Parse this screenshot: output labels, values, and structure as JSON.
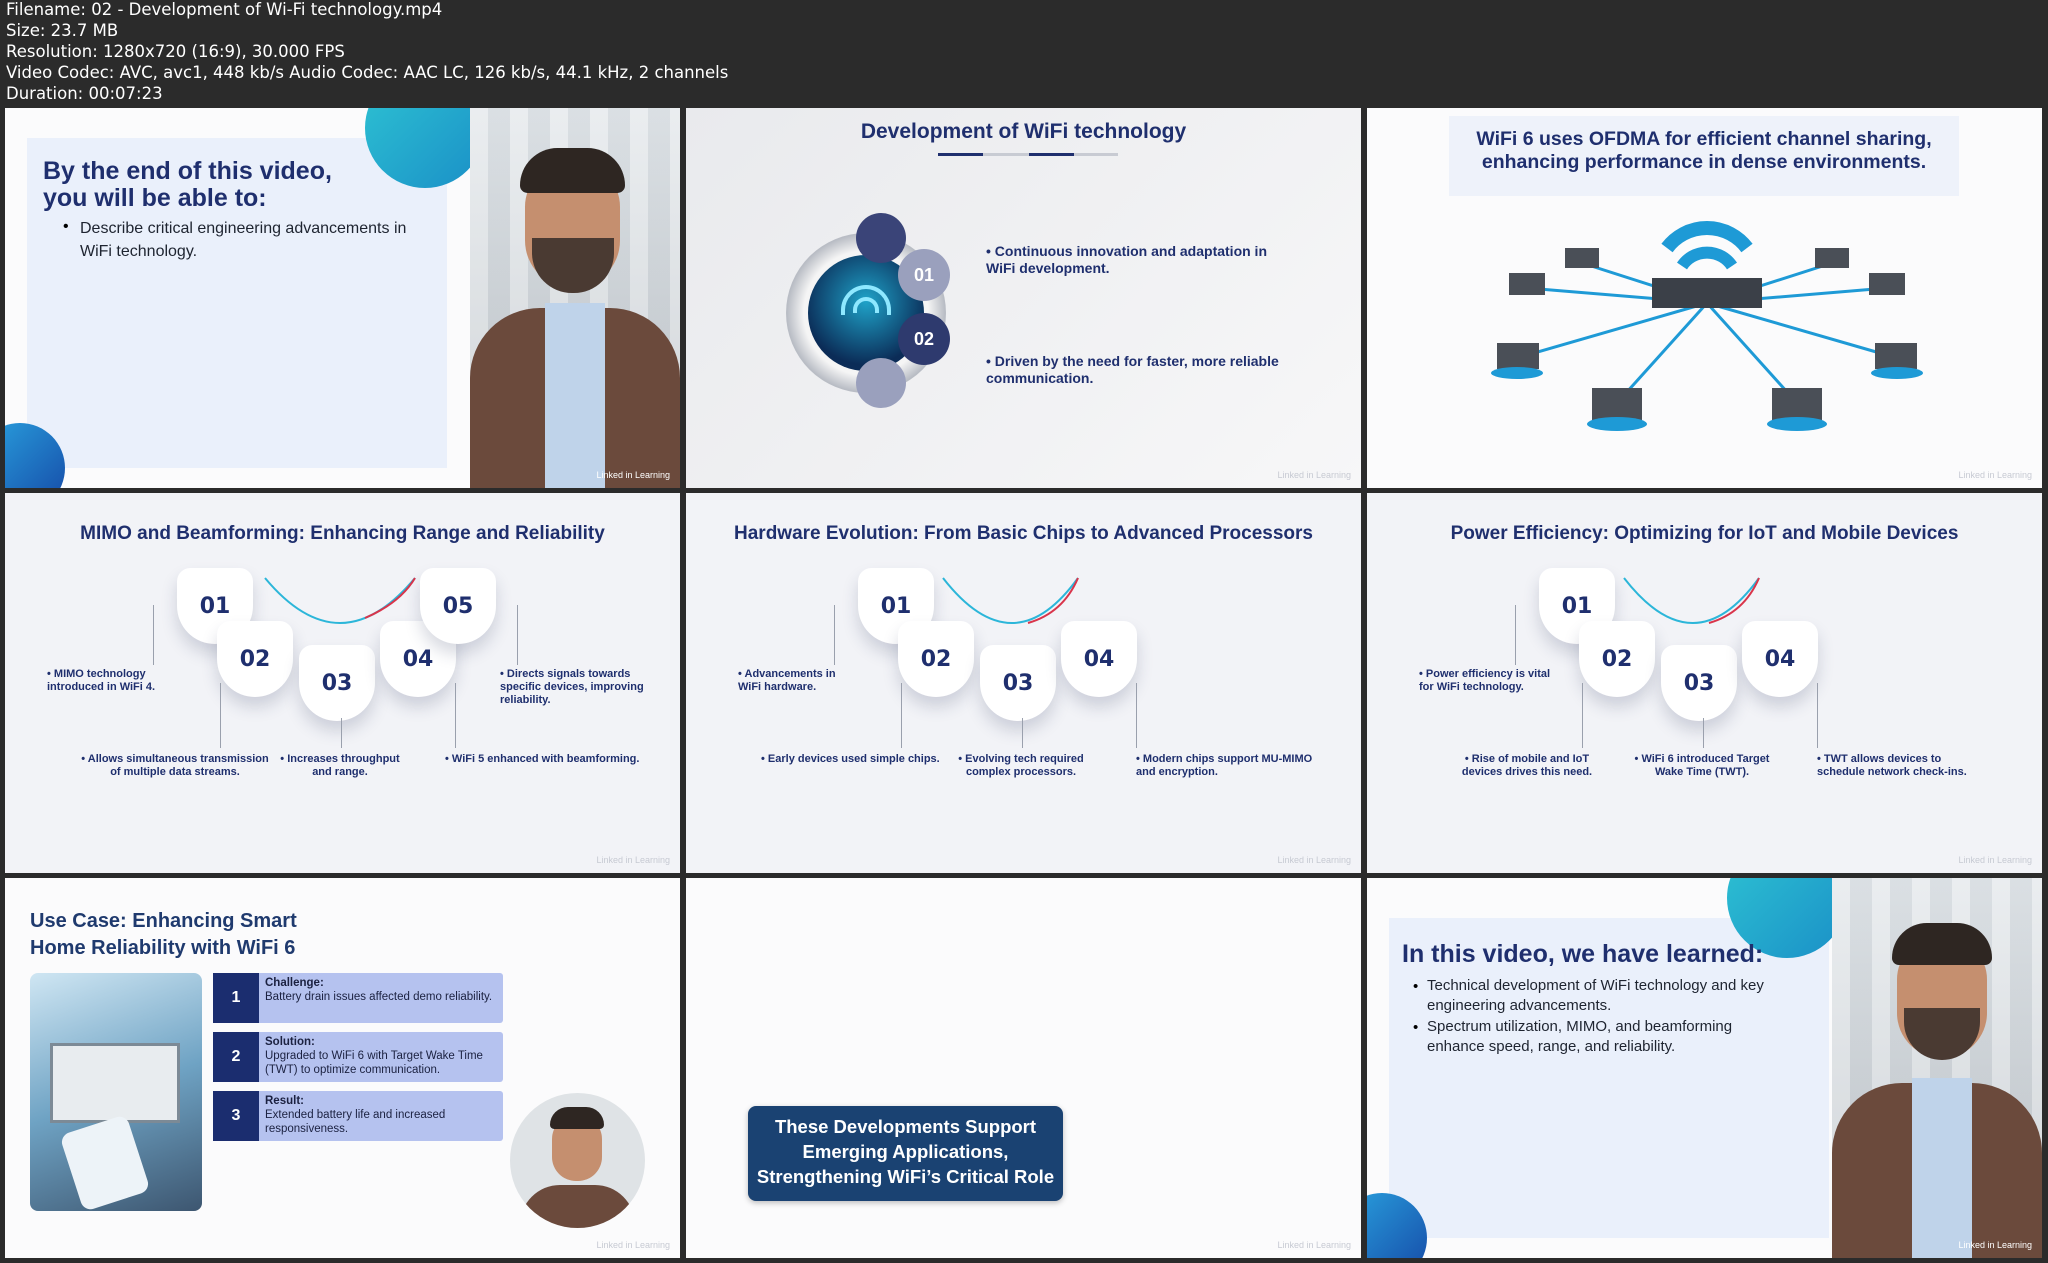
{
  "file_info": {
    "filename": "Filename: 02 - Development of Wi-Fi technology.mp4",
    "size": "Size: 23.7 MB",
    "resolution": "Resolution: 1280x720 (16:9), 30.000 FPS",
    "codec": "Video Codec: AVC, avc1, 448 kb/s Audio Codec: AAC LC, 126 kb/s, 44.1 kHz, 2 channels",
    "duration": "Duration: 00:07:23"
  },
  "frames": {
    "f1": {
      "heading": "By the end of this video, you will be able to:",
      "bullet": "Describe critical engineering advancements in WiFi technology.",
      "watermark": "Linked in Learning"
    },
    "f2": {
      "title": "Development of WiFi technology",
      "num1": "01",
      "num2": "02",
      "point1": "Continuous innovation and adaptation in WiFi development.",
      "point2": "Driven by the need for faster, more reliable communication.",
      "watermark": "Linked in Learning"
    },
    "f3": {
      "caption": "WiFi 6 uses OFDMA for efficient channel sharing, enhancing performance in dense environments.",
      "watermark": "Linked in Learning"
    },
    "f4": {
      "title": "MIMO and Beamforming: Enhancing Range and Reliability",
      "nums": [
        "01",
        "02",
        "03",
        "04",
        "05"
      ],
      "n1": "MIMO technology introduced in WiFi 4.",
      "n2": "Allows simultaneous transmission of multiple data streams.",
      "n3": "Increases throughput and range.",
      "n4": "WiFi 5 enhanced with beamforming.",
      "n5": "Directs signals towards specific devices, improving reliability.",
      "watermark": "Linked in Learning"
    },
    "f5": {
      "title": "Hardware Evolution: From Basic Chips to Advanced Processors",
      "nums": [
        "01",
        "02",
        "03",
        "04"
      ],
      "n1": "Advancements in WiFi hardware.",
      "n2": "Early devices used simple chips.",
      "n3": "Evolving tech required complex processors.",
      "n4": "Modern chips support MU-MIMO and encryption.",
      "watermark": "Linked in Learning"
    },
    "f6": {
      "title": "Power Efficiency: Optimizing for IoT and Mobile Devices",
      "nums": [
        "01",
        "02",
        "03",
        "04"
      ],
      "n1": "Power efficiency is vital for WiFi technology.",
      "n2": "Rise of mobile and IoT devices drives this need.",
      "n3": "WiFi 6 introduced Target Wake Time (TWT).",
      "n4": "TWT allows devices to schedule network check-ins.",
      "watermark": "Linked in Learning"
    },
    "f7": {
      "title": "Use Case: Enhancing Smart Home Reliability with WiFi 6",
      "rows": [
        {
          "num": "1",
          "head": "Challenge:",
          "text": "Battery drain issues affected demo reliability."
        },
        {
          "num": "2",
          "head": "Solution:",
          "text": "Upgraded to WiFi 6 with Target Wake Time (TWT) to optimize communication."
        },
        {
          "num": "3",
          "head": "Result:",
          "text": "Extended battery life and increased responsiveness."
        }
      ],
      "watermark": "Linked in Learning"
    },
    "f8": {
      "banner": "These Developments Support Emerging Applications, Strengthening WiFi’s Critical Role",
      "watermark": "Linked in Learning"
    },
    "f9": {
      "heading": "In this video, we have learned:",
      "bullet1": "Technical development of WiFi technology and key engineering advancements.",
      "bullet2": "Spectrum utilization, MIMO, and beamforming enhance speed, range, and reliability.",
      "watermark": "Linked in Learning"
    }
  },
  "colors": {
    "navy": "#1f2f6e",
    "teal": "#3fc8d6",
    "blue": "#1d6fc4",
    "background": "#2b2b2b"
  }
}
